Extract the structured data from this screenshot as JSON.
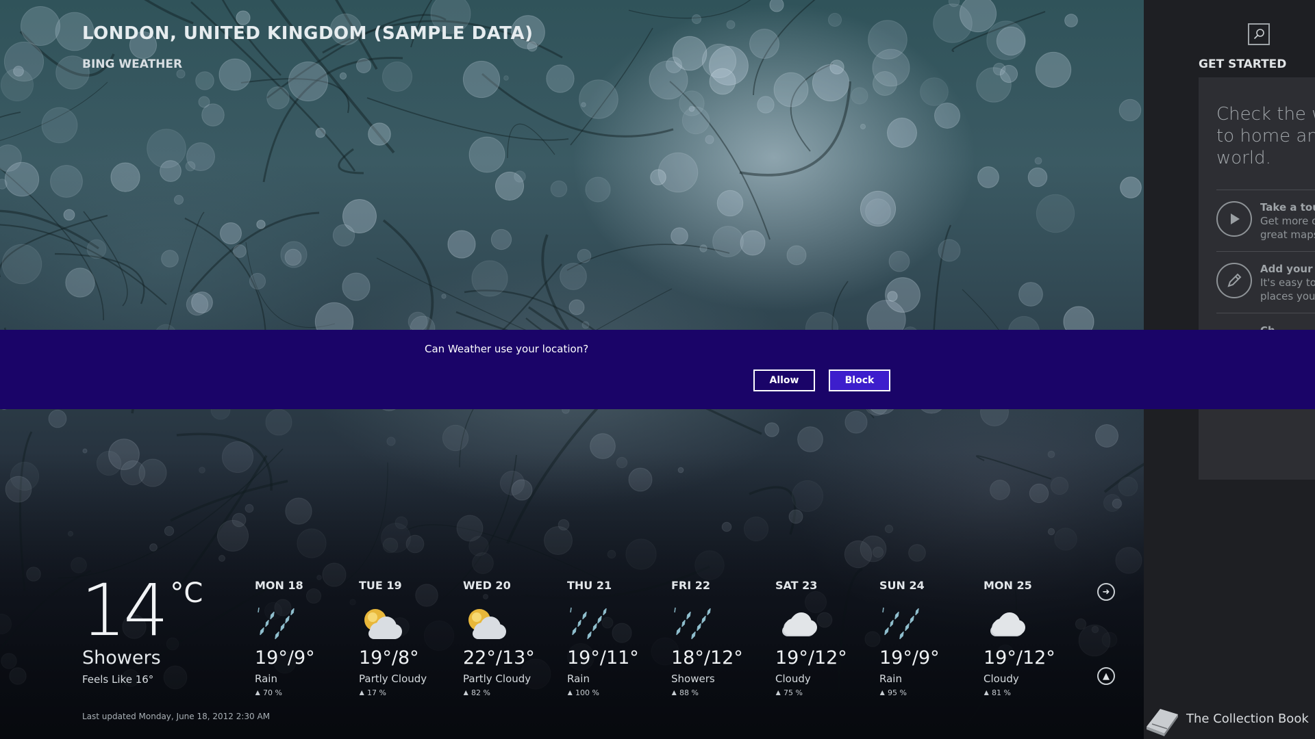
{
  "header": {
    "location": "LONDON, UNITED KINGDOM (SAMPLE DATA)",
    "app_name": "BING WEATHER"
  },
  "current": {
    "temperature": "14",
    "unit": "°C",
    "condition": "Showers",
    "feels_like": "Feels Like 16°"
  },
  "forecast": [
    {
      "day": "MON 18",
      "temps": "19°/9°",
      "condition": "Rain",
      "precip": "▲ 70 %",
      "icon": "rain-icon"
    },
    {
      "day": "TUE 19",
      "temps": "19°/8°",
      "condition": "Partly Cloudy",
      "precip": "▲ 17 %",
      "icon": "partly-cloudy-icon"
    },
    {
      "day": "WED 20",
      "temps": "22°/13°",
      "condition": "Partly Cloudy",
      "precip": "▲ 82 %",
      "icon": "partly-cloudy-icon"
    },
    {
      "day": "THU 21",
      "temps": "19°/11°",
      "condition": "Rain",
      "precip": "▲ 100 %",
      "icon": "rain-icon"
    },
    {
      "day": "FRI 22",
      "temps": "18°/12°",
      "condition": "Showers",
      "precip": "▲ 88 %",
      "icon": "showers-icon"
    },
    {
      "day": "SAT 23",
      "temps": "19°/12°",
      "condition": "Cloudy",
      "precip": "▲ 75 %",
      "icon": "cloudy-icon"
    },
    {
      "day": "SUN 24",
      "temps": "19°/9°",
      "condition": "Rain",
      "precip": "▲ 95 %",
      "icon": "rain-icon"
    },
    {
      "day": "MON 25",
      "temps": "19°/12°",
      "condition": "Cloudy",
      "precip": "▲ 81 %",
      "icon": "cloudy-icon"
    }
  ],
  "last_updated": "Last updated Monday, June 18, 2012 2:30 AM",
  "prompt": {
    "question": "Can Weather use your location?",
    "allow_label": "Allow",
    "block_label": "Block"
  },
  "side_panel": {
    "title": "GET STARTED",
    "headline": "Check the w\nto home and\nworld.",
    "items": [
      {
        "title": "Take a tour",
        "line1": "Get more ou",
        "line2": "great maps",
        "icon": "play-icon"
      },
      {
        "title": "Add your fa",
        "line1": "It's easy to f",
        "line2": "places you c",
        "icon": "pencil-icon"
      },
      {
        "title": "Ch",
        "line1": "",
        "line2": "",
        "icon": ""
      }
    ]
  },
  "taskbar_item": {
    "label": "The Collection Book",
    "icon": "book-icon"
  },
  "colors": {
    "prompt_bar": "#1a0468",
    "block_button": "#3d1ecc",
    "side_panel": "#1e1f23",
    "side_card": "#2d2e33"
  }
}
